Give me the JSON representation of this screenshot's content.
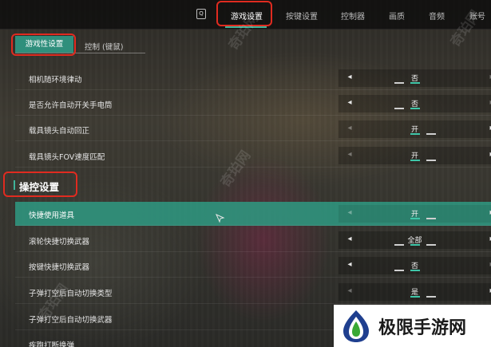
{
  "top_nav": {
    "key_hint": "Q",
    "tabs": [
      {
        "label": "游戏设置",
        "active": true
      },
      {
        "label": "按键设置",
        "active": false
      },
      {
        "label": "控制器",
        "active": false
      },
      {
        "label": "画质",
        "active": false
      },
      {
        "label": "音频",
        "active": false
      },
      {
        "label": "账号",
        "active": false
      }
    ]
  },
  "sub_tabs": {
    "active": "游戏性设置",
    "other": "控制 (键鼠)"
  },
  "settings_top": [
    {
      "label": "相机随环境律动",
      "value": "否"
    },
    {
      "label": "是否允许自动开关手电筒",
      "value": "否"
    },
    {
      "label": "载具镜头自动回正",
      "value": "开"
    },
    {
      "label": "载具镜头FOV速度匹配",
      "value": "开"
    }
  ],
  "section": {
    "title": "操控设置"
  },
  "settings_control": [
    {
      "label": "快捷使用道具",
      "value": "开"
    },
    {
      "label": "滚轮快捷切换武器",
      "value": "全部"
    },
    {
      "label": "按键快捷切换武器",
      "value": "否"
    },
    {
      "label": "子弹打空后自动切换类型",
      "value": "是"
    },
    {
      "label": "子弹打空后自动切换武器",
      "value": ""
    },
    {
      "label": "疾跑打断换弹",
      "value": ""
    }
  ],
  "watermarks": {
    "site": "奇珀网"
  },
  "brand": {
    "name": "极限手游网"
  },
  "colors": {
    "accent": "#2f9680",
    "highlight": "#e02b20"
  }
}
